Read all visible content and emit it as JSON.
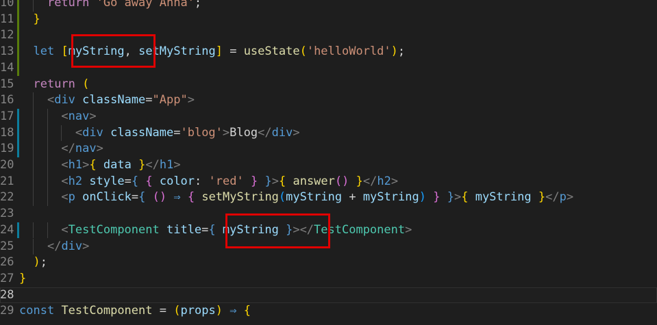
{
  "editor": {
    "lines": [
      {
        "number": "10",
        "code": "    return 'Go away Anna';"
      },
      {
        "number": "11",
        "code": "  }"
      },
      {
        "number": "12",
        "code": ""
      },
      {
        "number": "13",
        "code": "  let [myString, setMyString] = useState('helloWorld');"
      },
      {
        "number": "14",
        "code": ""
      },
      {
        "number": "15",
        "code": "  return ("
      },
      {
        "number": "16",
        "code": "    <div className=\"App\">"
      },
      {
        "number": "17",
        "code": "      <nav>"
      },
      {
        "number": "18",
        "code": "        <div className='blog'>Blog</div>"
      },
      {
        "number": "19",
        "code": "      </nav>"
      },
      {
        "number": "20",
        "code": "      <h1>{ data }</h1>"
      },
      {
        "number": "21",
        "code": "      <h2 style={ { color: 'red' } }>{ answer() }</h2>"
      },
      {
        "number": "22",
        "code": "      <p onClick={ () ⇒ { setMyString(myString + myString) } }>{ myString }</p>"
      },
      {
        "number": "23",
        "code": ""
      },
      {
        "number": "24",
        "code": "      <TestComponent title={ myString }></TestComponent>"
      },
      {
        "number": "25",
        "code": "    </div>"
      },
      {
        "number": "26",
        "code": "  );"
      },
      {
        "number": "27",
        "code": "}"
      },
      {
        "number": "28",
        "code": ""
      },
      {
        "number": "29",
        "code": "const TestComponent = (props) ⇒ {"
      }
    ],
    "current_line": "28",
    "annotations": [
      {
        "label": "highlight-box",
        "text": "[myString,"
      },
      {
        "label": "highlight-box",
        "text": "{ myString }"
      }
    ],
    "colors": {
      "background": "#1e1e1e",
      "highlight": "#e00000",
      "gutter_modified_green": "#587c0c",
      "gutter_modified_blue": "#0c7d9d"
    }
  }
}
